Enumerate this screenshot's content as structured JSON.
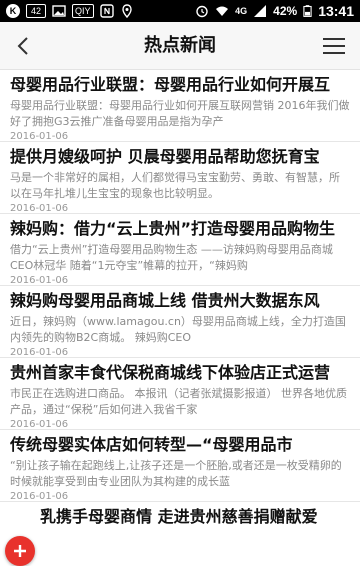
{
  "status_bar": {
    "badge_1": "42",
    "badge_2": "QIY",
    "network": "4G",
    "battery": "42%",
    "time": "13:41"
  },
  "header": {
    "title": "热点新闻"
  },
  "news": [
    {
      "title": "母婴用品行业联盟：母婴用品行业如何开展互",
      "summary": "母婴用品行业联盟：母婴用品行业如何开展互联网营销 2016年我们做好了拥抱G3云推广准备母婴用品是指为孕产",
      "date": "2016-01-06"
    },
    {
      "title": "提供月嫂级呵护 贝晨母婴用品帮助您抚育宝",
      "summary": "马是一个非常好的属相，人们都觉得马宝宝勤劳、勇敢、有智慧，所以在马年扎堆儿生宝宝的现象也比较明显。",
      "date": "2016-01-06"
    },
    {
      "title": "辣妈购：借力“云上贵州”打造母婴用品购物生",
      "summary": "借力“云上贵州”打造母婴用品购物生态 ——访辣妈购母婴用品商城CEO林冠华 随着“1元夺宝”帷幕的拉开，“辣妈购",
      "date": "2016-01-06"
    },
    {
      "title": "辣妈购母婴用品商城上线 借贵州大数据东风",
      "summary": "近日，辣妈购（www.lamagou.cn）母婴用品商城上线，全力打造国内领先的购物B2C商城。 辣妈购CEO",
      "date": "2016-01-06"
    },
    {
      "title": "贵州首家丰食代保税商城线下体验店正式运营",
      "summary": "市民正在选购进口商品。 本报讯（记者张斌摄影报道） 世界各地优质产品，通过“保税”后如何进入我省千家",
      "date": "2016-01-06"
    },
    {
      "title": "传统母婴实体店如何转型—“母婴用品市",
      "summary": "“别让孩子输在起跑线上,让孩子还是一个胚胎,或者还是一枚受精卵的时候就能享受到由专业团队为其构建的成长蓝",
      "date": "2016-01-06"
    },
    {
      "title": "乳携手母婴商情 走进贵州慈善捐赠献爱",
      "summary": "",
      "date": ""
    }
  ]
}
